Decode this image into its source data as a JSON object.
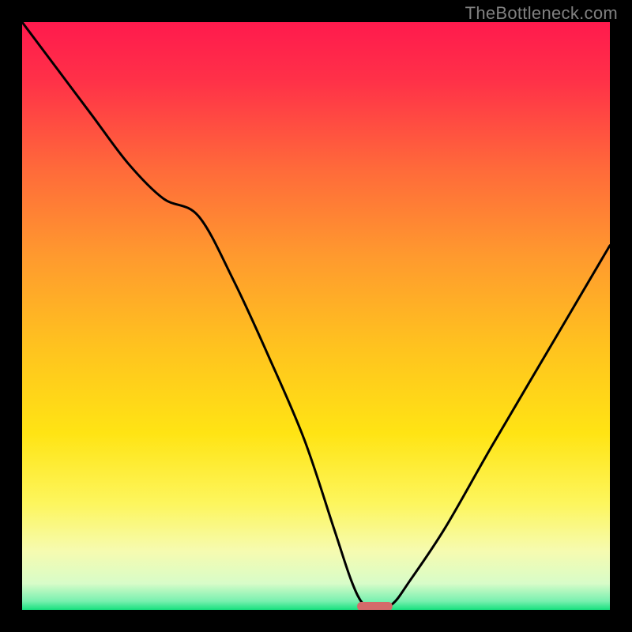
{
  "watermark": "TheBottleneck.com",
  "chart_data": {
    "type": "line",
    "title": "",
    "xlabel": "",
    "ylabel": "",
    "xlim": [
      0,
      100
    ],
    "ylim": [
      0,
      100
    ],
    "series": [
      {
        "name": "bottleneck-curve",
        "x": [
          0,
          6,
          12,
          18,
          24,
          30,
          36,
          42,
          48,
          53,
          56,
          58,
          60,
          63,
          66,
          72,
          80,
          90,
          100
        ],
        "y": [
          100,
          92,
          84,
          76,
          70,
          67,
          56,
          43,
          29,
          14,
          5,
          1,
          0,
          1,
          5,
          14,
          28,
          45,
          62
        ]
      },
      {
        "name": "sweet-spot-marker",
        "x": [
          57,
          63
        ],
        "y": [
          0.6,
          0.6
        ]
      }
    ],
    "gradient_stops": [
      {
        "offset": 0.0,
        "color": "#ff1a4d"
      },
      {
        "offset": 0.1,
        "color": "#ff3148"
      },
      {
        "offset": 0.25,
        "color": "#ff6a3a"
      },
      {
        "offset": 0.4,
        "color": "#ff9a2e"
      },
      {
        "offset": 0.55,
        "color": "#ffc21f"
      },
      {
        "offset": 0.7,
        "color": "#ffe414"
      },
      {
        "offset": 0.82,
        "color": "#fdf65e"
      },
      {
        "offset": 0.9,
        "color": "#f6fbb0"
      },
      {
        "offset": 0.955,
        "color": "#d8fcc8"
      },
      {
        "offset": 0.985,
        "color": "#79f0b0"
      },
      {
        "offset": 1.0,
        "color": "#17e07e"
      }
    ],
    "curve_color": "#000000",
    "marker_color": "#d46a6a"
  }
}
